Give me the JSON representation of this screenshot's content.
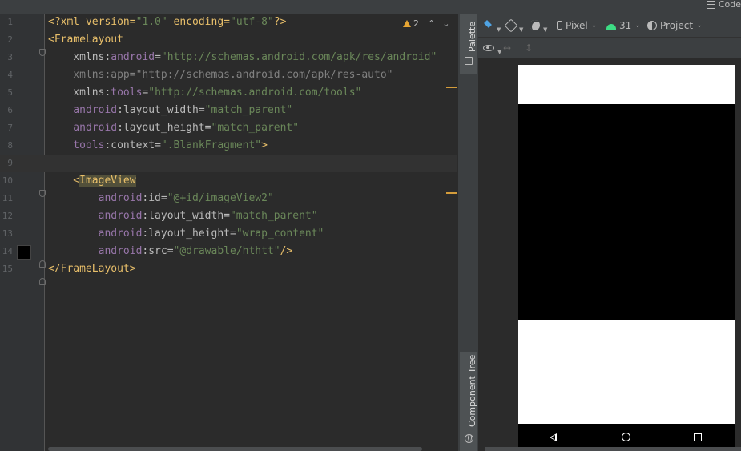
{
  "top_strip": {
    "code_label": "Code",
    "menu_icon": "hamburger-icon"
  },
  "editor": {
    "warnings": {
      "icon": "warning-icon",
      "count": "2"
    },
    "lines": [
      {
        "n": "1",
        "tokens": [
          [
            "t-pi",
            "<?xml version="
          ],
          [
            "t-val",
            "\"1.0\""
          ],
          [
            "t-pi",
            " encoding="
          ],
          [
            "t-val",
            "\"utf-8\""
          ],
          [
            "t-pi",
            "?>"
          ]
        ]
      },
      {
        "n": "2",
        "tokens": [
          [
            "t-tag",
            "<FrameLayout"
          ]
        ]
      },
      {
        "n": "3",
        "tokens": [
          [
            "t-attr",
            "    xmlns:"
          ],
          [
            "t-ns",
            "android"
          ],
          [
            "t-attr",
            "="
          ],
          [
            "t-val",
            "\"http://schemas.android.com/apk/res/android\""
          ]
        ]
      },
      {
        "n": "4",
        "tokens": [
          [
            "t-gray",
            "    xmlns:app="
          ],
          [
            "t-gray",
            "\"http://schemas.android.com/apk/res-auto\""
          ]
        ]
      },
      {
        "n": "5",
        "tokens": [
          [
            "t-attr",
            "    xmlns:"
          ],
          [
            "t-ns",
            "tools"
          ],
          [
            "t-attr",
            "="
          ],
          [
            "t-val",
            "\"http://schemas.android.com/tools\""
          ]
        ]
      },
      {
        "n": "6",
        "tokens": [
          [
            "t-ns",
            "    android"
          ],
          [
            "t-attr",
            ":layout_width="
          ],
          [
            "t-val",
            "\"match_parent\""
          ]
        ]
      },
      {
        "n": "7",
        "tokens": [
          [
            "t-ns",
            "    android"
          ],
          [
            "t-attr",
            ":layout_height="
          ],
          [
            "t-val",
            "\"match_parent\""
          ]
        ]
      },
      {
        "n": "8",
        "tokens": [
          [
            "t-ns",
            "    tools"
          ],
          [
            "t-attr",
            ":context="
          ],
          [
            "t-val",
            "\".BlankFragment\""
          ],
          [
            "t-tag",
            ">"
          ]
        ]
      },
      {
        "n": "9",
        "tokens": []
      },
      {
        "n": "10",
        "tokens": [
          [
            "t-tag",
            "    <"
          ],
          [
            "t-tag t-hl",
            "ImageView"
          ]
        ]
      },
      {
        "n": "11",
        "tokens": [
          [
            "t-ns",
            "        android"
          ],
          [
            "t-attr",
            ":id="
          ],
          [
            "t-val",
            "\"@+id/imageView2\""
          ]
        ]
      },
      {
        "n": "12",
        "tokens": [
          [
            "t-ns",
            "        android"
          ],
          [
            "t-attr",
            ":layout_width="
          ],
          [
            "t-val",
            "\"match_parent\""
          ]
        ]
      },
      {
        "n": "13",
        "tokens": [
          [
            "t-ns",
            "        android"
          ],
          [
            "t-attr",
            ":layout_height="
          ],
          [
            "t-val",
            "\"wrap_content\""
          ]
        ]
      },
      {
        "n": "14",
        "tokens": [
          [
            "t-ns",
            "        android"
          ],
          [
            "t-attr",
            ":src="
          ],
          [
            "t-val",
            "\"@drawable/hthtt\""
          ],
          [
            "t-tag",
            "/>"
          ]
        ]
      },
      {
        "n": "15",
        "tokens": [
          [
            "t-tag",
            "</FrameLayout>"
          ]
        ]
      }
    ]
  },
  "side_strip": {
    "palette_label": "Palette",
    "component_tree_label": "Component Tree"
  },
  "design_toolbar": {
    "device_label": "Pixel",
    "api_label": "31",
    "theme_label": "Project"
  },
  "colors": {
    "accent_blue": "#4fa3e3",
    "android_green": "#3ddc84",
    "warning": "#e6a533"
  }
}
